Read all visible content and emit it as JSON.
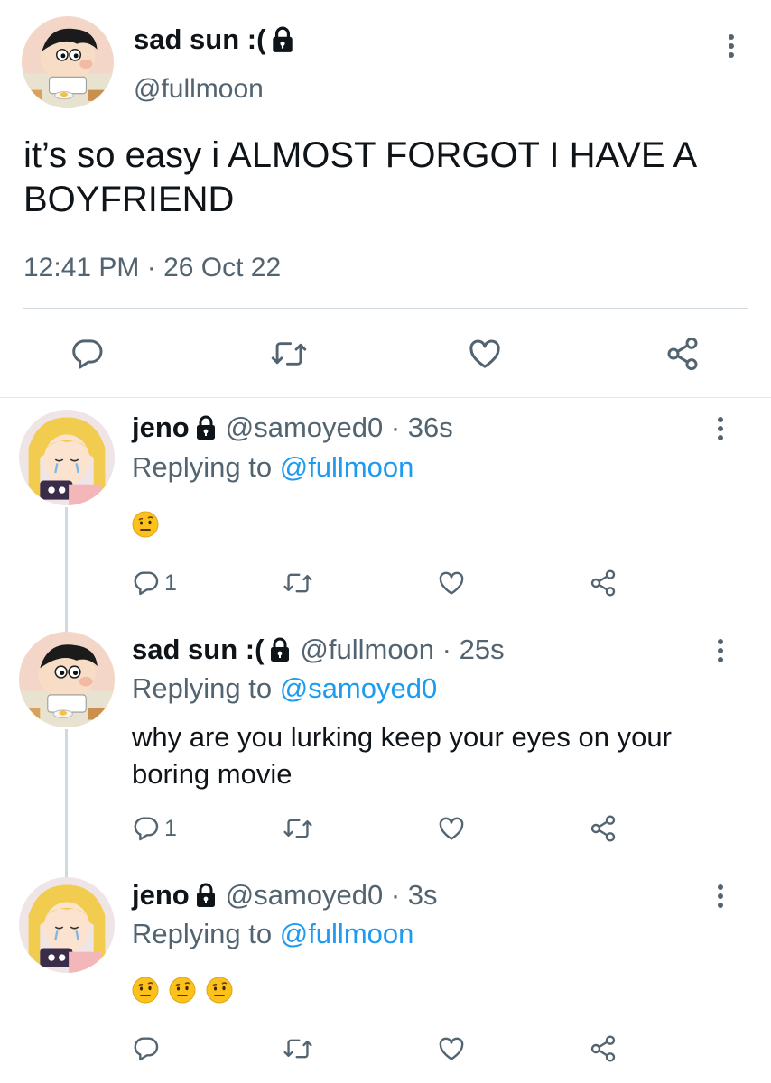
{
  "main_tweet": {
    "display_name": "sad sun :(",
    "handle": "@fullmoon",
    "text": "it’s so easy i ALMOST FORGOT I HAVE A BOYFRIEND",
    "timestamp": "12:41 PM · 26 Oct 22",
    "protected": true
  },
  "replies": [
    {
      "display_name": "jeno",
      "handle_time": "@samoyed0 · 36s",
      "replying_prefix": "Replying to ",
      "replying_to": "@fullmoon",
      "text": "",
      "emojis": [
        "raised-eyebrow-face"
      ],
      "reply_count": "1",
      "protected": true
    },
    {
      "display_name": "sad sun :(",
      "handle_time": "@fullmoon · 25s",
      "replying_prefix": "Replying to ",
      "replying_to": "@samoyed0",
      "text": "why are you lurking keep your eyes on your boring movie",
      "emojis": [],
      "reply_count": "1",
      "protected": true
    },
    {
      "display_name": "jeno",
      "handle_time": "@samoyed0 · 3s",
      "replying_prefix": "Replying to ",
      "replying_to": "@fullmoon",
      "text": "",
      "emojis": [
        "raised-eyebrow-face",
        "raised-eyebrow-face",
        "raised-eyebrow-face"
      ],
      "reply_count": "",
      "protected": true
    }
  ],
  "icons": {
    "reply": "reply-icon",
    "retweet": "retweet-icon",
    "like": "heart-icon",
    "share": "share-icon",
    "more": "more-options-icon",
    "lock": "lock-icon"
  },
  "colors": {
    "text": "#0f1419",
    "secondary": "#536471",
    "link": "#1d9bf0",
    "divider": "#cfd9de"
  }
}
